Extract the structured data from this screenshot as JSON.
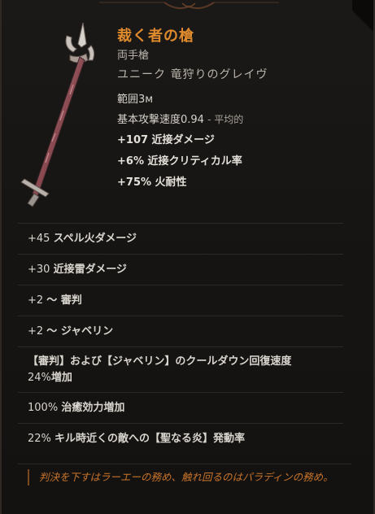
{
  "item": {
    "name": "裁く者の槍",
    "type": "両手槍",
    "rarity": "ユニーク 竜狩りのグレイヴ",
    "range": "範囲3м",
    "attack_speed": {
      "label": "基本攻撃速度0.94",
      "suffix": "- 平均的"
    },
    "implicits": [
      "+107 近接ダメージ",
      "+6% 近接クリティカル率",
      "+75% 火耐性"
    ],
    "affixes": [
      {
        "prefix": "+45 ",
        "text": "スペル火ダメージ"
      },
      {
        "prefix": "+30 ",
        "text": "近接雷ダメージ"
      },
      {
        "prefix": "+2 ",
        "text": "〜 審判"
      },
      {
        "prefix": "+2 ",
        "text": "〜 ジャベリン"
      },
      {
        "prefix": "",
        "text": "【審判】および【ジャベリン】のクールダウン回復速度",
        "suffix_plain": "24%",
        "suffix": "増加"
      },
      {
        "prefix": "100% ",
        "text": "治癒効力増加"
      },
      {
        "prefix": "22% ",
        "text": "キル時近くの敵への【聖なる炎】発動率"
      }
    ],
    "flavor": "判決を下すはラーエーの務め、触れ回るのはパラディンの務め。"
  },
  "colors": {
    "name": "#e08a2e",
    "flavor": "#c8742a",
    "text": "#d7d3cd",
    "background": "#171513"
  },
  "icons": {
    "weapon": "glaive-spear-icon",
    "ornament": "top-ornament-icon"
  }
}
